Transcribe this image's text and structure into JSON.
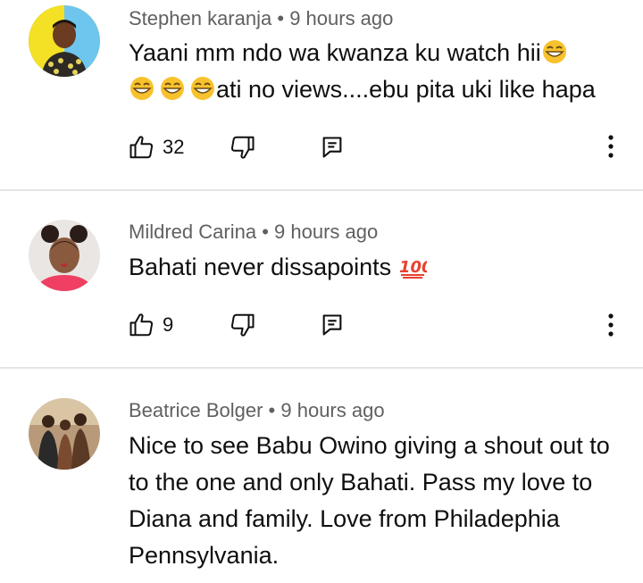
{
  "comments": [
    {
      "author": "Stephen karanja",
      "time": "9 hours ago",
      "text_line1": "Yaani mm ndo wa kwanza ku watch hii",
      "text_line2": "ati no views....ebu pita uki like hapa",
      "likes": "32",
      "separator": "•"
    },
    {
      "author": "Mildred Carina",
      "time": "9 hours ago",
      "text": "Bahati never dissapoints ",
      "likes": "9",
      "separator": "•"
    },
    {
      "author": "Beatrice Bolger",
      "time": "9 hours ago",
      "text": "Nice to see Babu Owino giving a shout out to to the one and only Bahati. Pass my love to Diana and family. Love from Philadephia Pennsylvania.",
      "separator": "•"
    }
  ],
  "colors": {
    "meta": "#606060",
    "text": "#0f0f0f",
    "divider": "#e5e5e5"
  },
  "icons": [
    "thumb-up-icon",
    "thumb-down-icon",
    "reply-icon",
    "more-vert-icon",
    "grinning-emoji",
    "hundred-points-emoji"
  ]
}
